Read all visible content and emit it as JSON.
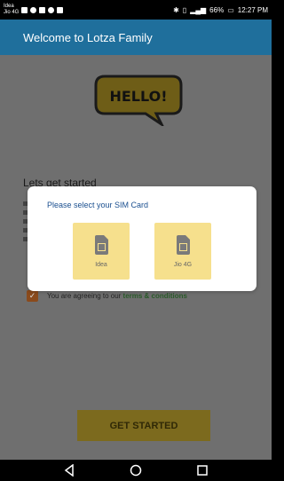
{
  "status": {
    "carrier_top": "Idea",
    "carrier_bottom": "Jio 4G",
    "battery": "66%",
    "time": "12:27 PM"
  },
  "appbar": {
    "title": "Welcome to Lotza Family"
  },
  "hero": {
    "text": "HELLO!"
  },
  "content": {
    "heading": "Lets get started",
    "agree_text": "You are agreeing to our ",
    "terms_link": "terms & conditions"
  },
  "dialog": {
    "title": "Please select your SIM Card",
    "options": [
      {
        "label": "Idea"
      },
      {
        "label": "Jio 4G"
      }
    ]
  },
  "buttons": {
    "get_started": "GET STARTED"
  },
  "colors": {
    "appbar": "#1f6f9c",
    "sim_card_bg": "#f6e08d",
    "checkbox": "#8a4a1c",
    "terms_link": "#2a5a2a"
  }
}
